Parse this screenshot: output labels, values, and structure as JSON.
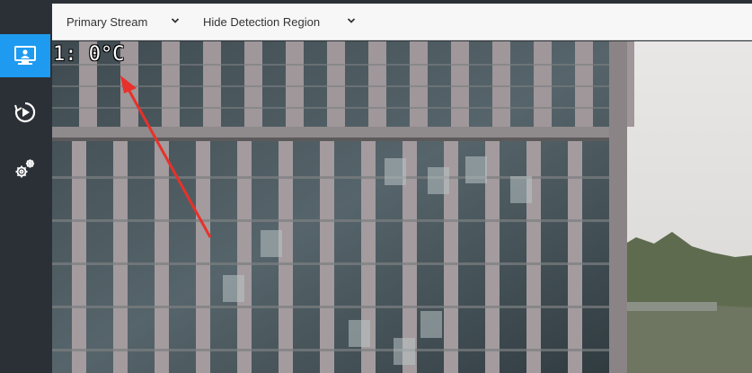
{
  "sidebar": {
    "items": [
      {
        "icon": "live-view-icon",
        "active": true
      },
      {
        "icon": "playback-icon",
        "active": false
      },
      {
        "icon": "settings-gears-icon",
        "active": false
      }
    ]
  },
  "toolbar": {
    "stream_select": {
      "value": "Primary Stream"
    },
    "region_select": {
      "value": "Hide Detection Region"
    }
  },
  "video": {
    "osd_text": "1: 0°C",
    "annotation": "red-arrow"
  },
  "colors": {
    "accent": "#1e9bf0",
    "sidebar_bg": "#2b3036",
    "toolbar_bg": "#f7f7f7",
    "arrow": "#e8312a"
  }
}
